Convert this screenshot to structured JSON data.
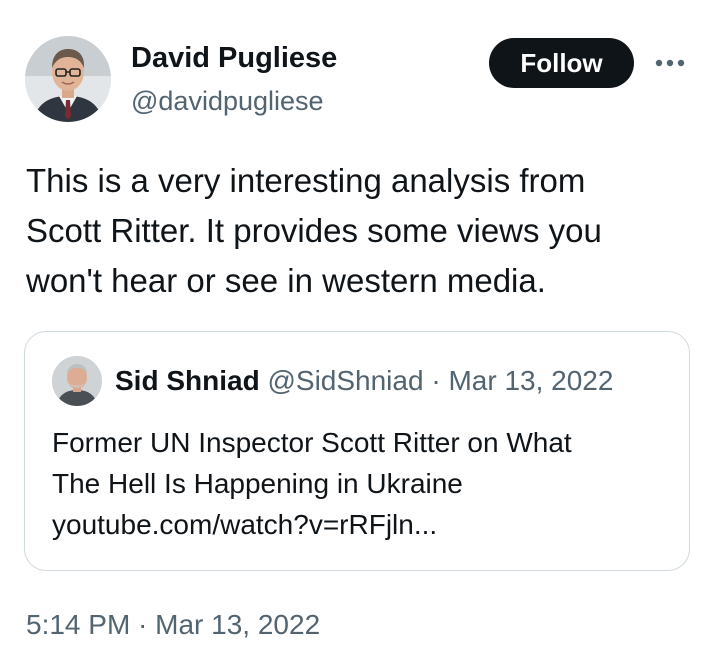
{
  "author": {
    "display_name": "David Pugliese",
    "handle": "@davidpugliese"
  },
  "actions": {
    "follow_label": "Follow",
    "more_icon": "more-horizontal-icon"
  },
  "tweet": {
    "text_lines": [
      "This is a very interesting analysis from",
      "Scott Ritter. It provides some views you",
      "won't hear or see in western media."
    ],
    "timestamp": "5:14 PM · Mar 13, 2022"
  },
  "quoted_tweet": {
    "display_name": "Sid Shniad",
    "handle": "@SidShniad",
    "separator": "·",
    "date": "Mar 13, 2022",
    "text_lines": [
      "Former UN Inspector Scott Ritter on What",
      "The Hell Is Happening in Ukraine",
      "youtube.com/watch?v=rRFjln..."
    ]
  },
  "colors": {
    "primary_text": "#0f1419",
    "secondary_text": "#536471",
    "follow_button_bg": "#0f1419",
    "card_border": "#cfd9de"
  }
}
